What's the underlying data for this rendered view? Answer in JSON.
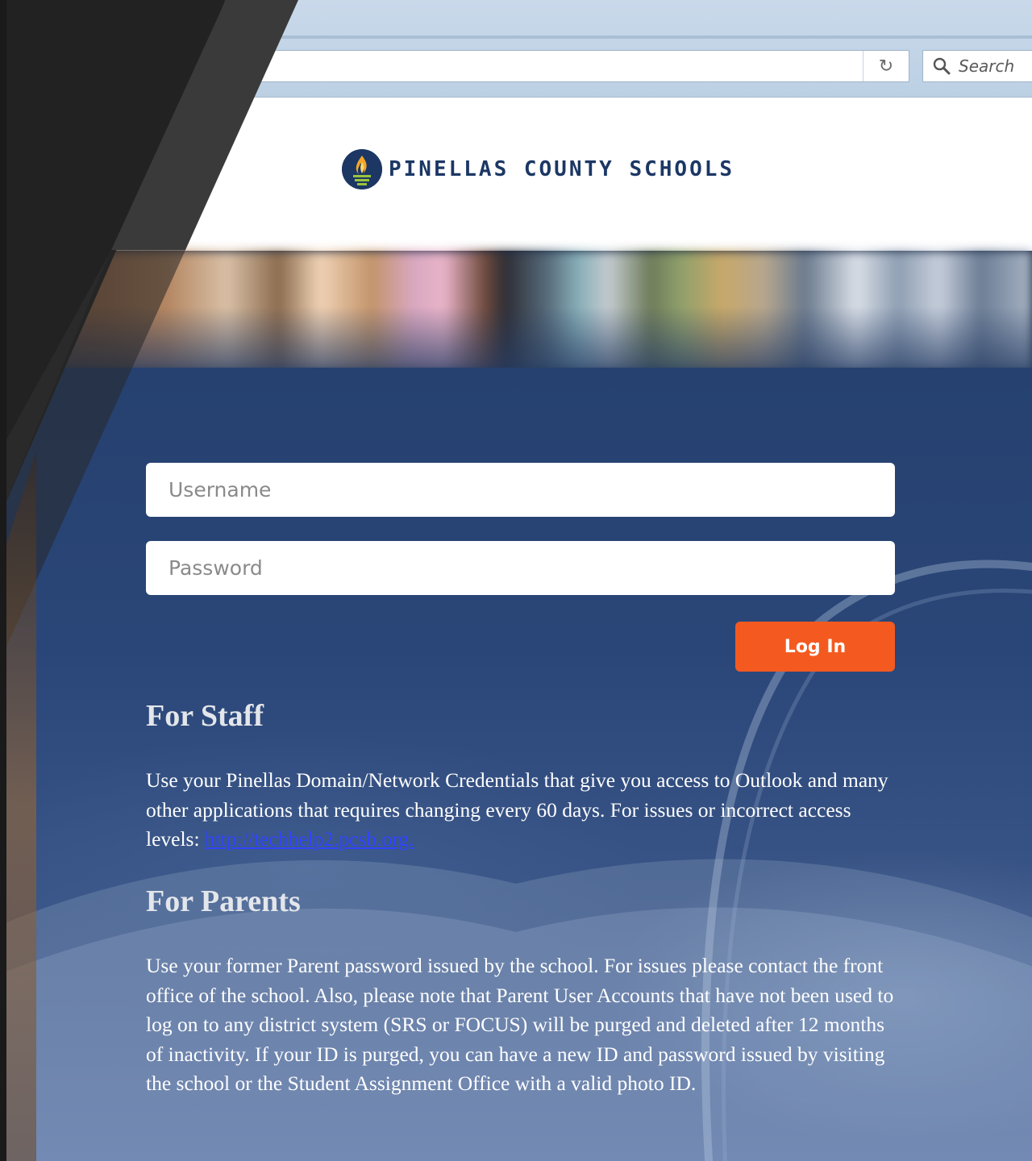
{
  "browser": {
    "reload_icon": "reload-icon",
    "search": {
      "placeholder": "Search",
      "icon": "search-icon"
    }
  },
  "brand": {
    "name": "PINELLAS COUNTY SCHOOLS",
    "logo_icon": "torch-icon",
    "color": "#1c3764"
  },
  "login": {
    "username_placeholder": "Username",
    "password_placeholder": "Password",
    "submit_label": "Log In",
    "submit_color": "#f45a20"
  },
  "staff": {
    "heading": "For Staff",
    "text": "Use your Pinellas Domain/Network Credentials that give you access to Outlook and many other applications that requires changing every 60 days. For issues or incorrect access levels: ",
    "link_text": "http://techhelp2.pcsb.org."
  },
  "parents": {
    "heading": "For Parents",
    "text": "Use your former Parent password issued by the school. For issues please contact the front office of the school. Also, please note that Parent User Accounts that have not been used to log on to any district system (SRS or FOCUS) will be purged and deleted after 12 months of inactivity. If your ID is purged, you can have a new ID and password issued by visiting the school or the Student Assignment Office with a valid photo ID."
  },
  "colors": {
    "panel_blue": "#2a4678",
    "link_blue": "#2f44ff",
    "overlay_dark": "#252525"
  }
}
